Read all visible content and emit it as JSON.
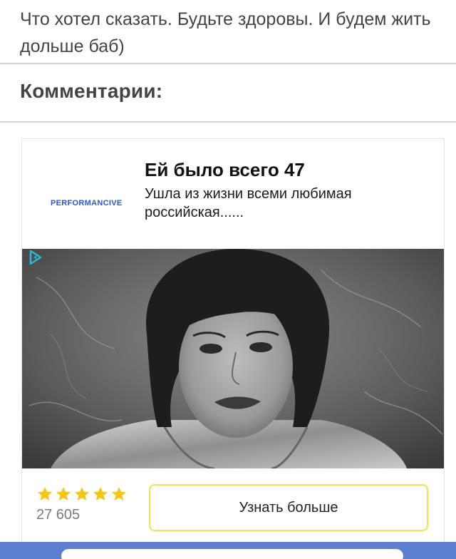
{
  "article": {
    "text": "Что хотел сказать. Будьте здоровы. И будем жить дольше баб)"
  },
  "comments": {
    "heading": "Комментарии:"
  },
  "ad": {
    "advertiser": "PERFORMANCIVE",
    "title": "Ей было всего 47",
    "description": "Ушла из жизни всеми любимая российская......",
    "rating_stars": 5,
    "rating_count": "27 605",
    "cta_label": "Узнать больше",
    "colors": {
      "star": "#f5c518",
      "cta_border": "#f7e14a",
      "advertiser": "#2f56c8",
      "ad_choices": "#2bb8d6"
    }
  },
  "bottom_bar": {
    "color": "#5b7fd0"
  }
}
